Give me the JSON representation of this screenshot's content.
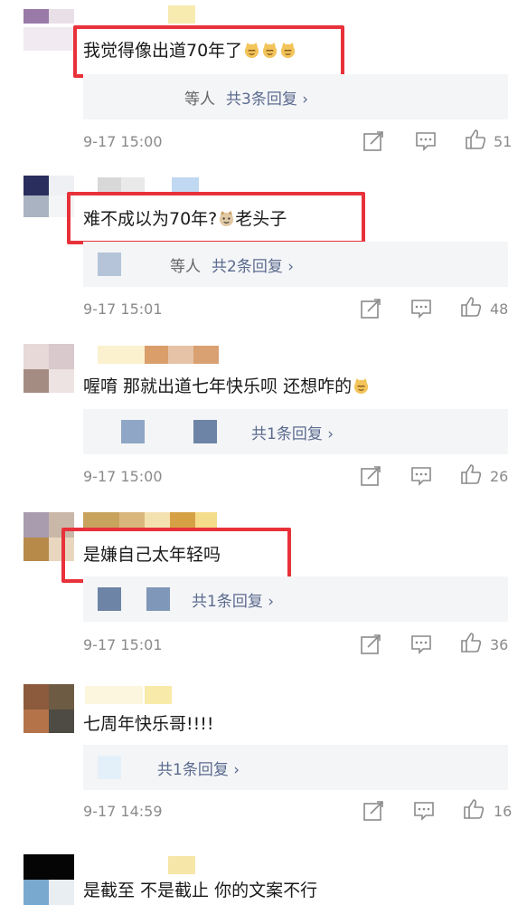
{
  "comments": [
    {
      "text": "我觉得像出道70年了",
      "emoji_count": 3,
      "reply_prefix": "等人",
      "reply_label": "共3条回复 ›",
      "time": "9-17 15:00",
      "likes": "51",
      "highlighted": true
    },
    {
      "text_before": "难不成以为70年?",
      "text_after": "老头子",
      "reply_prefix": "等人",
      "reply_label": "共2条回复 ›",
      "time": "9-17 15:01",
      "likes": "48",
      "highlighted": true
    },
    {
      "text": "喔唷 那就出道七年快乐呗 还想咋的",
      "reply_label": "共1条回复 ›",
      "time": "9-17 15:00",
      "likes": "26",
      "highlighted": false
    },
    {
      "text": "是嫌自己太年轻吗",
      "reply_label": "共1条回复 ›",
      "time": "9-17 15:01",
      "likes": "36",
      "highlighted": true
    },
    {
      "text": "七周年快乐哥!!!!",
      "reply_label": "共1条回复 ›",
      "time": "9-17 14:59",
      "likes": "16",
      "highlighted": false
    },
    {
      "text": "是截至 不是截止 你的文案不行",
      "highlighted": false
    }
  ],
  "icons": {
    "share": "share-edit-icon",
    "comment": "comment-icon",
    "like": "thumbs-up-icon",
    "emoji": "cat-emoji-icon"
  },
  "colors": {
    "highlight": "#e8313a",
    "reply_link": "#5b6b8f",
    "meta": "#8a8a8a"
  }
}
